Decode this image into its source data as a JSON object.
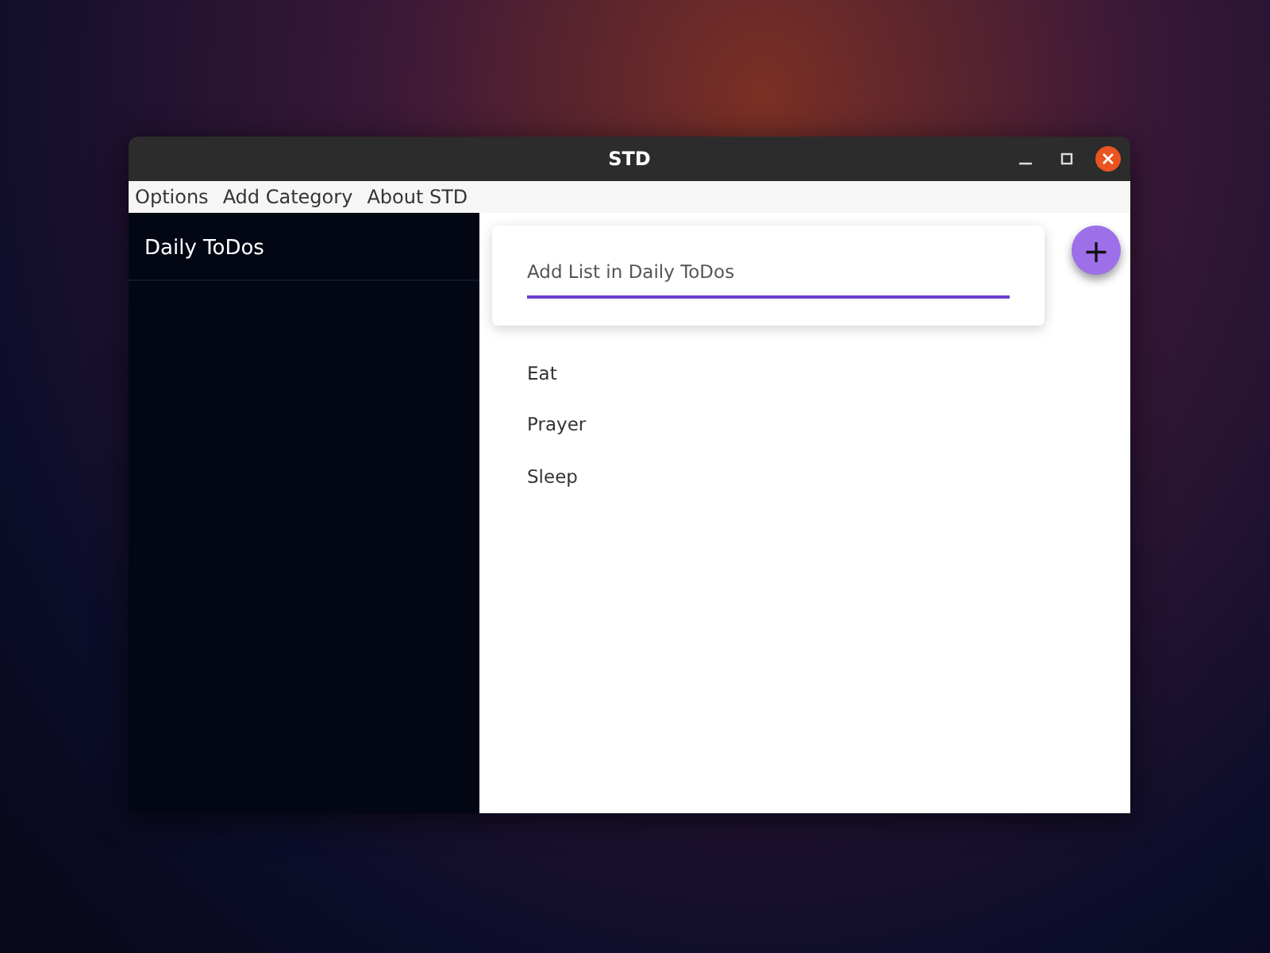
{
  "window": {
    "title": "STD"
  },
  "menu": [
    "Options",
    "Add Category",
    "About STD"
  ],
  "sidebar": {
    "items": [
      {
        "label": "Daily ToDos"
      }
    ]
  },
  "add_list": {
    "placeholder": "Add List in Daily ToDos"
  },
  "fab": {
    "label": "+"
  },
  "items": [
    {
      "label": "Eat"
    },
    {
      "label": "Prayer"
    },
    {
      "label": "Sleep"
    }
  ]
}
